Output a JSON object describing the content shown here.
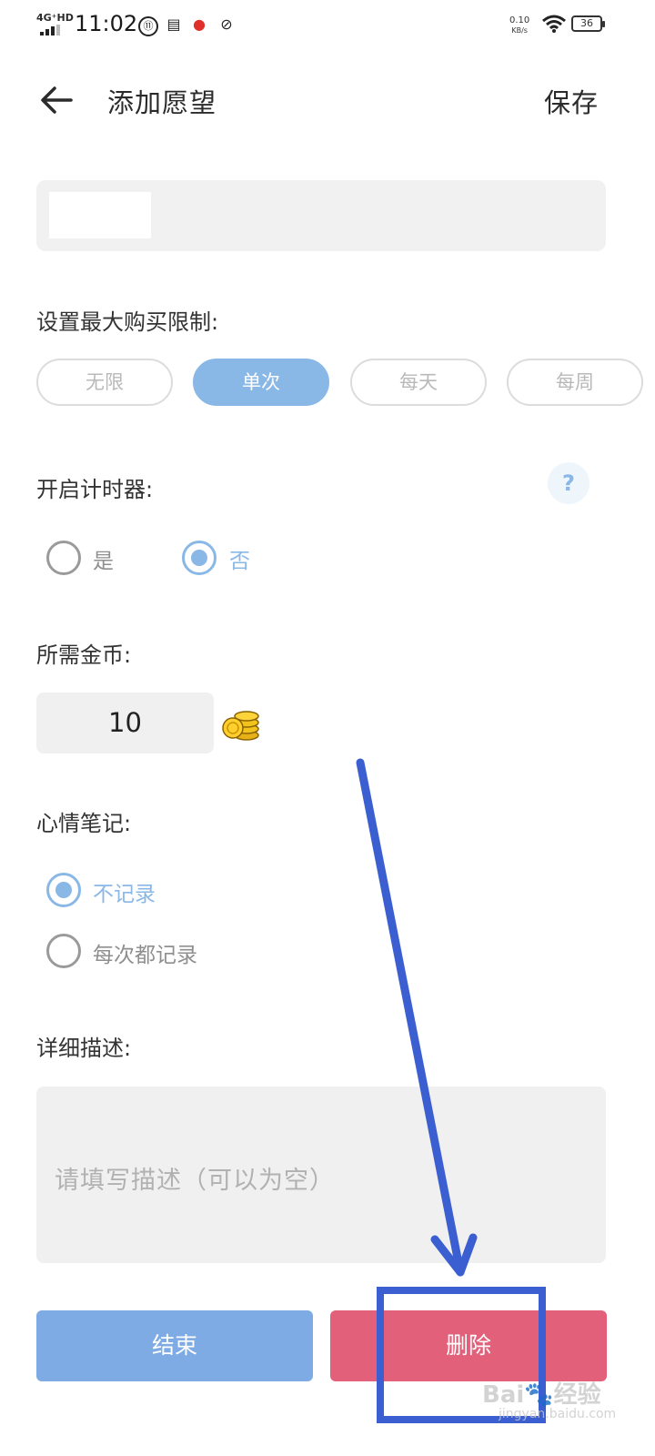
{
  "status_bar": {
    "network": "4G⁺HD",
    "time": "11:02",
    "speed_value": "0.10",
    "speed_unit": "KB/s",
    "battery": "36"
  },
  "header": {
    "title": "添加愿望",
    "save_label": "保存"
  },
  "purchase_limit": {
    "label": "设置最大购买限制:",
    "options": [
      "无限",
      "单次",
      "每天",
      "每周"
    ],
    "selected": "单次"
  },
  "timer": {
    "label": "开启计时器:",
    "help": "?",
    "options": [
      "是",
      "否"
    ],
    "selected": "否"
  },
  "coins": {
    "label": "所需金币:",
    "value": "10"
  },
  "mood_note": {
    "label": "心情笔记:",
    "options": [
      "不记录",
      "每次都记录"
    ],
    "selected": "不记录"
  },
  "description": {
    "label": "详细描述:",
    "placeholder": "请填写描述（可以为空）"
  },
  "buttons": {
    "end_label": "结束",
    "delete_label": "删除"
  },
  "watermark": {
    "text": "Bai🐾经验",
    "sub": "jingyan.baidu.com"
  },
  "colors": {
    "accent": "#8ab8e6",
    "end_button": "#7eabe3",
    "delete_button": "#e3607a",
    "annotation": "#3b5fd1"
  }
}
